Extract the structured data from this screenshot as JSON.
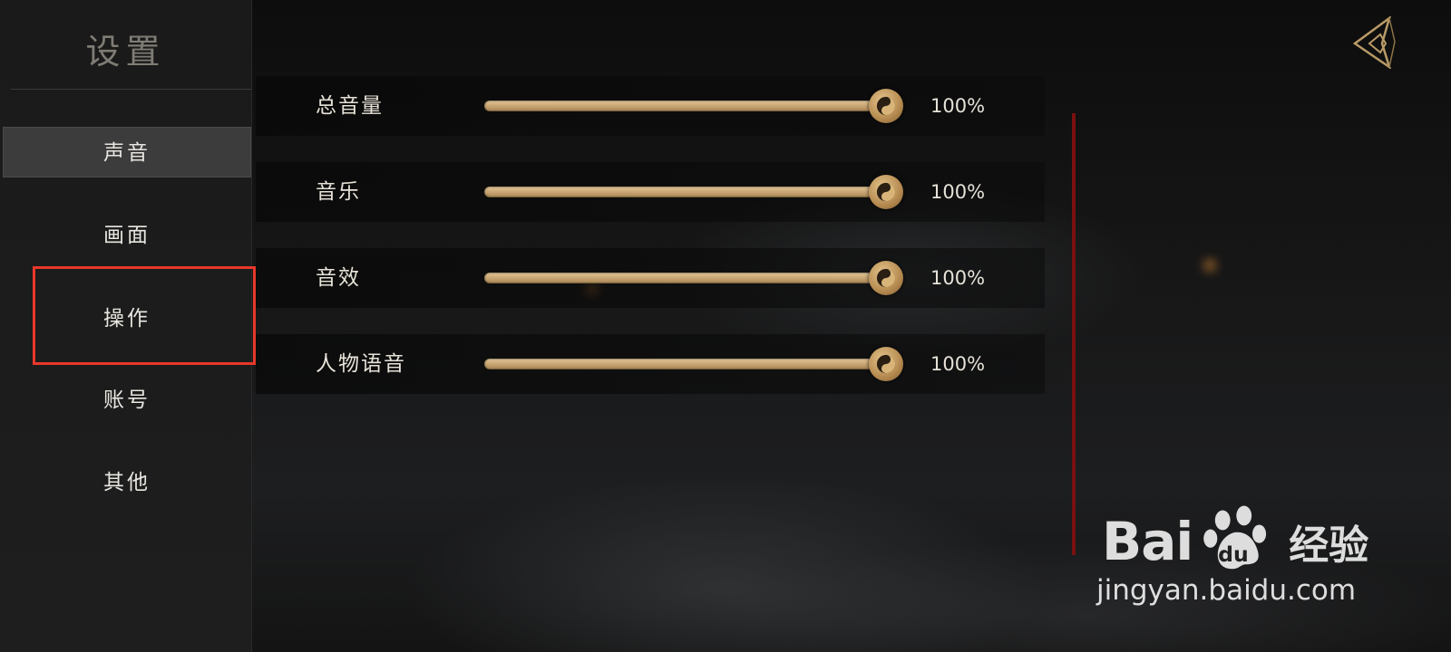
{
  "sidebar": {
    "title": "设置",
    "items": [
      {
        "label": "声音",
        "active": true
      },
      {
        "label": "画面",
        "active": false
      },
      {
        "label": "操作",
        "active": false
      },
      {
        "label": "账号",
        "active": false
      },
      {
        "label": "其他",
        "active": false
      }
    ]
  },
  "sliders": [
    {
      "label": "总音量",
      "value": 100,
      "value_text": "100%"
    },
    {
      "label": "音乐",
      "value": 100,
      "value_text": "100%"
    },
    {
      "label": "音效",
      "value": 100,
      "value_text": "100%"
    },
    {
      "label": "人物语音",
      "value": 100,
      "value_text": "100%"
    }
  ],
  "watermark": {
    "logo_left": "Bai",
    "logo_right": "经验",
    "url": "jingyan.baidu.com"
  },
  "colors": {
    "highlight": "#e8382a",
    "slider_gold": "#c6a370",
    "active_item_bg": "#3c3c3c"
  },
  "icons": {
    "back": "back-diamond-icon",
    "knob": "yin-yang-icon"
  }
}
